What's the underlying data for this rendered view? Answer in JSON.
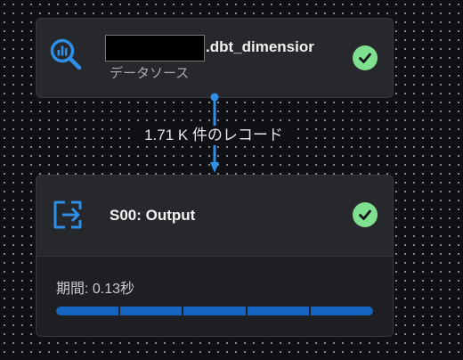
{
  "source_node": {
    "name_suffix": ".dbt_dimensior",
    "type_label": "データソース",
    "icon": "search-analytics-icon",
    "status_icon": "check-circle-icon"
  },
  "connector": {
    "label": "1.71 K 件のレコード"
  },
  "output_node": {
    "title": "S00: Output",
    "icon": "output-export-icon",
    "status_icon": "check-circle-icon",
    "duration_label": "期間: 0.13秒",
    "progress": 1.0
  },
  "colors": {
    "accent_blue": "#2f8ee5",
    "success_green": "#7fe08f",
    "progress_blue": "#1565c0"
  }
}
